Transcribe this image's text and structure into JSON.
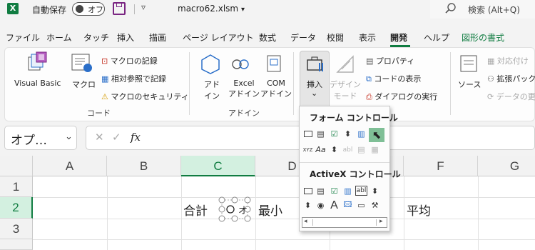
{
  "titlebar": {
    "app_logo": "X",
    "autosave_label": "自動保存",
    "autosave_state": "オフ",
    "qat_more": "▿",
    "filename": "macro62.xlsm",
    "filename_caret": "▾",
    "search_placeholder": "検索 (Alt+Q)"
  },
  "tabs": [
    "ファイル",
    "ホーム",
    "タッチ",
    "挿入",
    "描画",
    "ページ レイアウト",
    "数式",
    "データ",
    "校閲",
    "表示",
    "開発",
    "ヘルプ",
    "図形の書式"
  ],
  "active_tab": "開発",
  "ribbon": {
    "code_group": {
      "label": "コード",
      "visual_basic": "Visual Basic",
      "macro": "マクロ",
      "record_macro": "マクロの記録",
      "relative_ref": "相対参照で記録",
      "macro_security": "マクロのセキュリティ"
    },
    "addin_group": {
      "label": "アドイン",
      "addin_line1": "アド",
      "addin_line2": "イン",
      "excel_addin_line1": "Excel",
      "excel_addin_line2": "アドイン",
      "com_addin_line1": "COM",
      "com_addin_line2": "アドイン"
    },
    "controls_group": {
      "insert_label": "挿入",
      "insert_caret": "⌄",
      "design_mode_line1": "デザイン",
      "design_mode_line2": "モード",
      "properties": "プロパティ",
      "view_code": "コードの表示",
      "run_dialog": "ダイアログの実行"
    },
    "xml_group": {
      "source": "ソース",
      "map_properties": "対応付け",
      "expansion_packs": "拡張パック",
      "refresh_data": "データの更"
    }
  },
  "formula_bar": {
    "namebox": "オプ…",
    "namebox_caret": "⌄",
    "cancel": "✕",
    "enter": "✓",
    "fx": "fx"
  },
  "grid": {
    "columns": [
      "A",
      "B",
      "C",
      "D",
      "E",
      "F",
      "G"
    ],
    "rows": [
      "1",
      "2",
      "3"
    ],
    "selected_col": "C",
    "selected_row": "2",
    "cells": {
      "C2": "合計",
      "C2_option_label": "オ",
      "D2": "最小",
      "F2": "平均"
    }
  },
  "control_menu": {
    "form_title": "フォーム コントロール",
    "activex_title": "ActiveX コントロール",
    "form_label_icon": "Aa",
    "form_groupbox_icon": "XYZ",
    "form_textfield_icon": "abl",
    "activex_textbox_icon": "abl",
    "activex_label_icon": "A"
  },
  "colors": {
    "excel_green": "#107c41",
    "accent_purple": "#7a2582",
    "selection_fill": "#d3f0e0",
    "highlight": "#7fbf96"
  }
}
